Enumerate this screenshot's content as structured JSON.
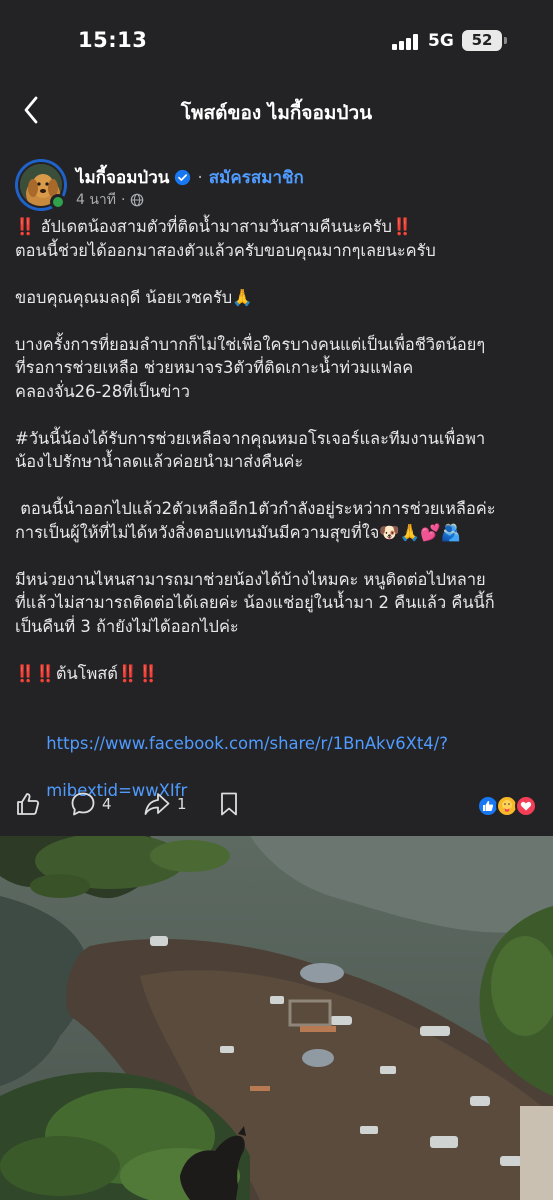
{
  "status_bar": {
    "time": "15:13",
    "network": "5G",
    "battery": "52"
  },
  "header": {
    "title": "โพสต์ของ ไมกี้จอมป่วน"
  },
  "post": {
    "author": "ไมกี้จอมป่วน",
    "join_label": "สมัครสมาชิก",
    "time_ago": "4 นาที",
    "body": [
      "‼️ อัปเดตน้องสามตัวที่ติดน้ำมาสามวันสามคืนนะครับ‼️",
      "ตอนนี้ช่วยได้ออกมาสองตัวแล้วครับขอบคุณมากๆเลยนะครับ",
      "",
      "ขอบคุณคุณมลฤดี น้อยเวชครับ🙏",
      "",
      "บางครั้งการที่ยอมลำบากก็ไม่ใช่เพื่อใครบางคนแต่เป็นเพื่อชีวิตน้อยๆ",
      "ที่รอการช่วยเหลือ ช่วยหมาจร3ตัวที่ติดเกาะน้ำท่วมแฟลค",
      "คลองจั่น26-28ที่เป็นข่าว",
      "",
      "#วันนี้น้องได้รับการช่วยเหลือจากคุณหมอโรเจอร์และทีมงานเพื่อพา",
      "น้องไปรักษาน้ำลดแล้วค่อยนำมาส่งคืนค่ะ",
      "",
      " ตอนนี้นำออกไปแล้ว2ตัวเหลืออีก1ตัวกำลังอยู่ระหว่าการช่วยเหลือค่ะ",
      "การเป็นผู้ให้ที่ไม่ได้หวังสิ่งตอบแทนมันมีความสุขที่ใจ🐶🙏💕🫂",
      "",
      "มีหน่วยงานไหนสามารถมาช่วยน้องได้บ้างไหมคะ หนูติดต่อไปหลาย",
      "ที่แล้วไม่สามารถติดต่อได้เลยค่ะ น้องแช่อยู่ในน้ำมา 2 คืนแล้ว คืนนี้ก็",
      "เป็นคืนที่ 3 ถ้ายังไม่ได้ออกไปค่ะ",
      "",
      "‼️‼️ต้นโพสต์‼️‼️",
      ""
    ],
    "link_line1": "https://www.facebook.com/share/r/1BnAkv6Xt4/?",
    "link_line2": "mibextid=wwXIfr"
  },
  "actions": {
    "comment_count": "4",
    "share_count": "1",
    "like_icon": "thumbs-up-icon",
    "comment_icon": "comment-bubble-icon",
    "share_icon": "share-arrow-icon",
    "save_icon": "bookmark-icon",
    "reactions": [
      "like",
      "care",
      "love"
    ]
  },
  "colors": {
    "background": "#232325",
    "accent_link": "#4f9bff",
    "like_blue": "#1877f2",
    "love_red": "#f33e58",
    "care_yellow": "#f7b928"
  }
}
